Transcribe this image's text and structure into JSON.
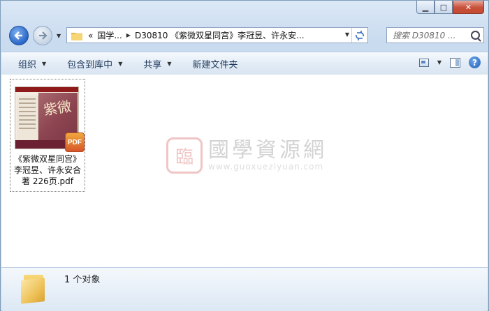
{
  "window": {
    "caption_buttons": {
      "minimize": "▁",
      "maximize": "□",
      "close": "✕"
    }
  },
  "nav": {
    "back_icon": "back-arrow-icon",
    "forward_icon": "forward-arrow-icon",
    "address": {
      "overflow": "«",
      "crumb1": "国学...",
      "crumb2": "D30810 《紫微双星同宫》李冠昱、许永安..."
    },
    "search_placeholder": "搜索 D30810 ..."
  },
  "toolbar": {
    "organize": "组织",
    "include_library": "包含到库中",
    "share": "共享",
    "new_folder": "新建文件夹"
  },
  "files": [
    {
      "name_line1": "《紫微双星同宫》",
      "name_line2": "李冠昱、许永安合",
      "name_line3": "著 226页.pdf",
      "badge": "PDF",
      "thumb_title": "紫微"
    }
  ],
  "watermark": {
    "cn": "國學資源網",
    "en": "www.guoxueziyuan.com",
    "seal": "臨"
  },
  "status": {
    "count_text": "1 个对象"
  }
}
